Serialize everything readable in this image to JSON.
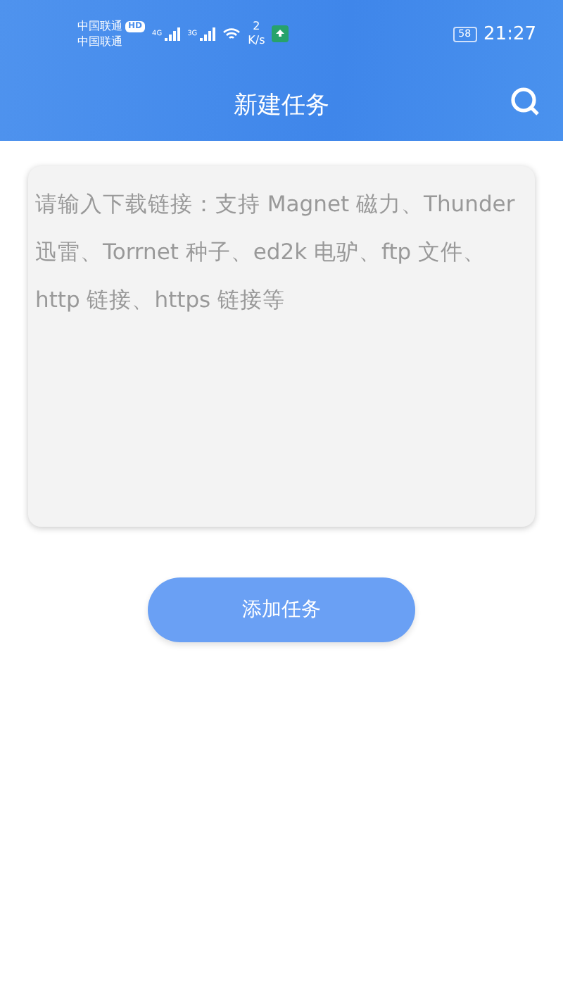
{
  "status_bar": {
    "carriers": [
      "中国联通",
      "中国联通"
    ],
    "hd_badge": "HD",
    "networks": [
      "4G",
      "3G"
    ],
    "speed_value": "2",
    "speed_unit": "K/s",
    "battery": "58",
    "time": "21:27"
  },
  "header": {
    "title": "新建任务"
  },
  "link_input": {
    "placeholder": "请输入下载链接：支持 Magnet 磁力、Thunder 迅雷、Torrnet 种子、ed2k 电驴、ftp 文件、http 链接、https 链接等"
  },
  "add_button": {
    "label": "添加任务"
  }
}
